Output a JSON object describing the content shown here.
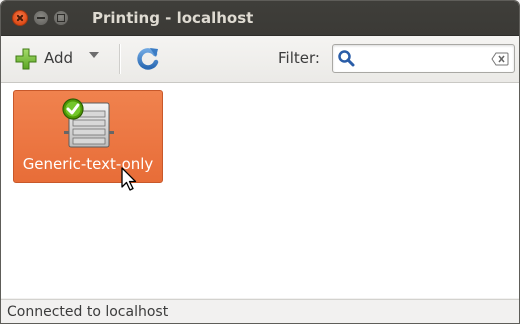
{
  "window": {
    "title": "Printing - localhost"
  },
  "toolbar": {
    "add_label": "Add",
    "filter_label": "Filter:",
    "filter_value": "",
    "icons": {
      "add": "plus-icon",
      "refresh": "refresh-icon",
      "search": "search-icon",
      "clear": "clear-icon"
    }
  },
  "printers": [
    {
      "name": "Generic-text-only",
      "selected": true,
      "is_default": true
    }
  ],
  "statusbar": {
    "text": "Connected to localhost"
  },
  "colors": {
    "selection": "#e86d38",
    "titlebar": "#3c3b37",
    "close_button": "#df4b16"
  }
}
